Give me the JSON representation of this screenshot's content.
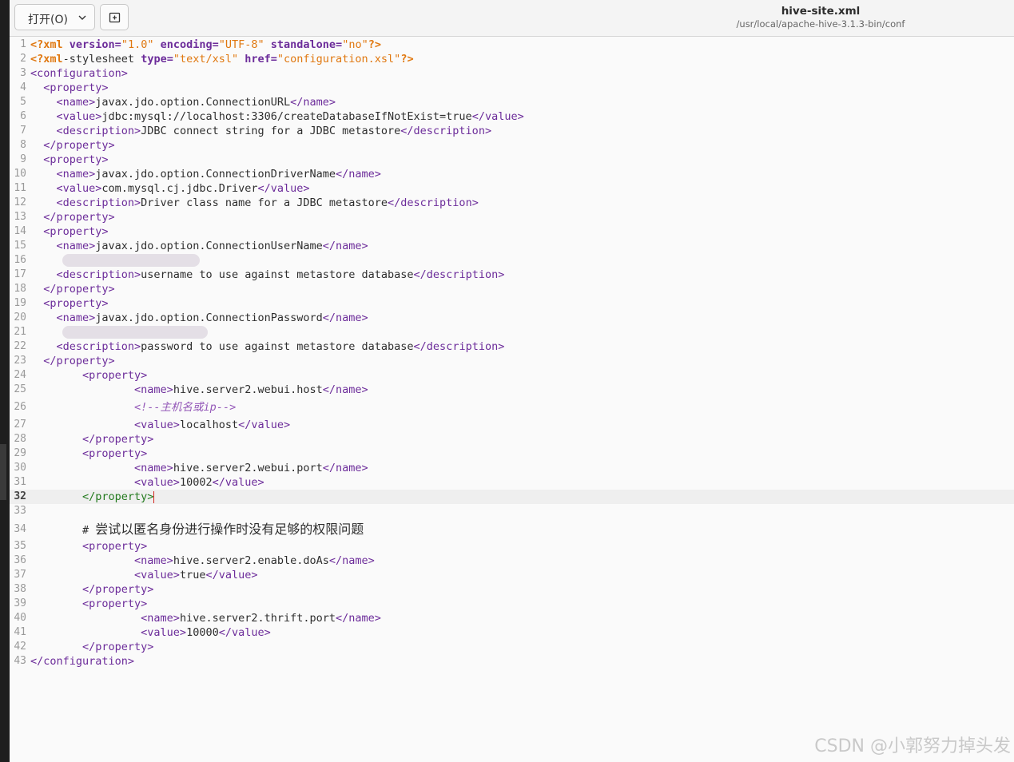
{
  "header": {
    "open_label": "打开(O)",
    "open_icon": "chevron-down-icon",
    "new_icon": "new-tab-icon",
    "file_title": "hive-site.xml",
    "file_path": "/usr/local/apache-hive-3.1.3-bin/conf"
  },
  "editor": {
    "current_line": 32,
    "lines": [
      {
        "n": "1"
      },
      {
        "n": "2"
      },
      {
        "n": "3"
      },
      {
        "n": "4"
      },
      {
        "n": "5"
      },
      {
        "n": "6"
      },
      {
        "n": "7"
      },
      {
        "n": "8"
      },
      {
        "n": "9"
      },
      {
        "n": "10"
      },
      {
        "n": "11"
      },
      {
        "n": "12"
      },
      {
        "n": "13"
      },
      {
        "n": "14"
      },
      {
        "n": "15"
      },
      {
        "n": "16"
      },
      {
        "n": "17"
      },
      {
        "n": "18"
      },
      {
        "n": "19"
      },
      {
        "n": "20"
      },
      {
        "n": "21"
      },
      {
        "n": "22"
      },
      {
        "n": "23"
      },
      {
        "n": "24"
      },
      {
        "n": "25"
      },
      {
        "n": "26"
      },
      {
        "n": "27"
      },
      {
        "n": "28"
      },
      {
        "n": "29"
      },
      {
        "n": "30"
      },
      {
        "n": "31"
      },
      {
        "n": "32"
      },
      {
        "n": "33"
      },
      {
        "n": "34"
      },
      {
        "n": "35"
      },
      {
        "n": "36"
      },
      {
        "n": "37"
      },
      {
        "n": "38"
      },
      {
        "n": "39"
      },
      {
        "n": "40"
      },
      {
        "n": "41"
      },
      {
        "n": "42"
      },
      {
        "n": "43"
      }
    ],
    "text": {
      "l1_a": "<?xml ",
      "l1_b": "version=",
      "l1_c": "\"1.0\" ",
      "l1_d": "encoding=",
      "l1_e": "\"UTF-8\" ",
      "l1_f": "standalone=",
      "l1_g": "\"no\"",
      "l1_h": "?>",
      "l2_a": "<?xml",
      "l2_b": "-stylesheet ",
      "l2_c": "type=",
      "l2_d": "\"text/xsl\" ",
      "l2_e": "href=",
      "l2_f": "\"configuration.xsl\"",
      "l2_g": "?>",
      "l3": "<configuration>",
      "l4": "  <property>",
      "l5_a": "    <name>",
      "l5_b": "javax.jdo.option.ConnectionURL",
      "l5_c": "</name>",
      "l6_a": "    <value>",
      "l6_b": "jdbc:mysql://localhost:3306/",
      "l6_c": "createDatabaseIfNotExist=true",
      "l6_d": "</value>",
      "l7_a": "    <description>",
      "l7_b": "JDBC connect string for a JDBC metastore",
      "l7_c": "</description>",
      "l8": "  </property>",
      "l9": "  <property>",
      "l10_a": "    <name>",
      "l10_b": "javax.jdo.option.ConnectionDriverName",
      "l10_c": "</name>",
      "l11_a": "    <value>",
      "l11_b": "com.mysql.cj.jdbc.Driver",
      "l11_c": "</value>",
      "l12_a": "    <description>",
      "l12_b": "Driver class name for a JDBC metastore",
      "l12_c": "</description>",
      "l13": "  </property>",
      "l14": "  <property>",
      "l15_a": "    <name>",
      "l15_b": "javax.jdo.option.ConnectionUserName",
      "l15_c": "</name>",
      "l17_a": "    <description>",
      "l17_b": "username to use against metastore database",
      "l17_c": "</description>",
      "l18": "  </property>",
      "l19": "  <property>",
      "l20_a": "    <name>",
      "l20_b": "javax.jdo.option.ConnectionPassword",
      "l20_c": "</name>",
      "l22_a": "    <description>",
      "l22_b": "password to use against metastore database",
      "l22_c": "</description>",
      "l23": "  </property>",
      "l24": "        <property>",
      "l25_a": "                <name>",
      "l25_b": "hive.server2.webui.host",
      "l25_c": "</name>",
      "l26_a": "                ",
      "l26_b": "<!--主机名或ip-->",
      "l27_a": "                <value>",
      "l27_b": "localhost",
      "l27_c": "</value>",
      "l28": "        </property>",
      "l29": "        <property>",
      "l30_a": "                <name>",
      "l30_b": "hive.server2.webui.port",
      "l30_c": "</name>",
      "l31_a": "                <value>",
      "l31_b": "10002",
      "l31_c": "</value>",
      "l32": "        </property>",
      "l34_a": "        # ",
      "l34_b": "尝试以匿名身份进行操作时没有足够的权限问题",
      "l35": "        <property>",
      "l36_a": "                <name>",
      "l36_b": "hive.server2.enable.doAs",
      "l36_c": "</name>",
      "l37_a": "                <value>",
      "l37_b": "true",
      "l37_c": "</value>",
      "l38": "        </property>",
      "l39": "        <property>",
      "l40_a": "                 <name>",
      "l40_b": "hive.server2.thrift.port",
      "l40_c": "</name>",
      "l41_a": "                 <value>",
      "l41_b": "10000",
      "l41_c": "</value>",
      "l42": "        </property>",
      "l43": "</configuration>"
    }
  },
  "watermark": "CSDN @小郭努力掉头发",
  "colors": {
    "keyword": "#6c2c9a",
    "string": "#e07810",
    "comment": "#9458b8",
    "matched_tag": "#237a1e"
  }
}
